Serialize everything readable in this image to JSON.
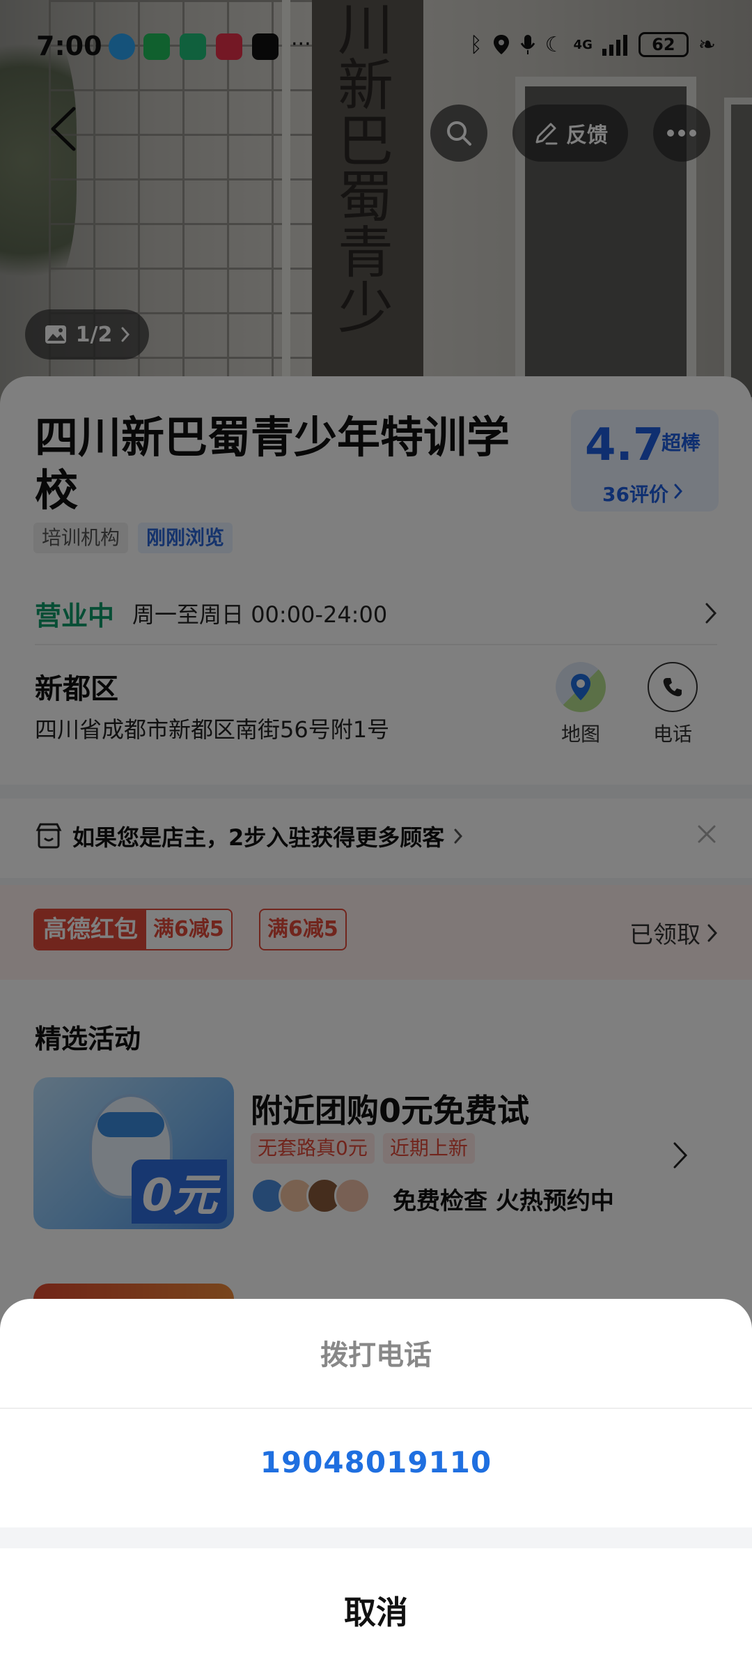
{
  "status_bar": {
    "time": "7:00",
    "network": "4G",
    "battery": "62"
  },
  "hero": {
    "plaque_text": "川新巴蜀青少",
    "photo_count": "1/2"
  },
  "top_bar": {
    "feedback_label": "反馈"
  },
  "poi": {
    "title": "四川新巴蜀青少年特训学校",
    "rating_score": "4.7",
    "rating_tag": "超棒",
    "rating_count": "36评价",
    "tags": [
      "培训机构",
      "刚刚浏览"
    ],
    "open_status": "营业中",
    "hours": "周一至周日 00:00-24:00",
    "district": "新都区",
    "address": "四川省成都市新都区南街56号附1号",
    "map_label": "地图",
    "phone_label": "电话"
  },
  "owner_banner": {
    "text": "如果您是店主，2步入驻获得更多顾客"
  },
  "coupons": {
    "main_label": "高德红包",
    "main_amount": "满6减5",
    "second_amount": "满6减5",
    "claimed": "已领取"
  },
  "activities": {
    "section_title": "精选活动",
    "items": [
      {
        "title": "附近团购0元免费试",
        "tags": [
          "无套路真0元",
          "近期上新"
        ],
        "badge": "0元",
        "desc": "免费检查 火热预约中"
      }
    ]
  },
  "call_sheet": {
    "title": "拨打电话",
    "phone_number": "19048019110",
    "cancel": "取消"
  },
  "colors": {
    "accent_blue": "#1f5fe0",
    "open_green": "#0f9d6a",
    "coupon_red": "#e34a3a"
  }
}
